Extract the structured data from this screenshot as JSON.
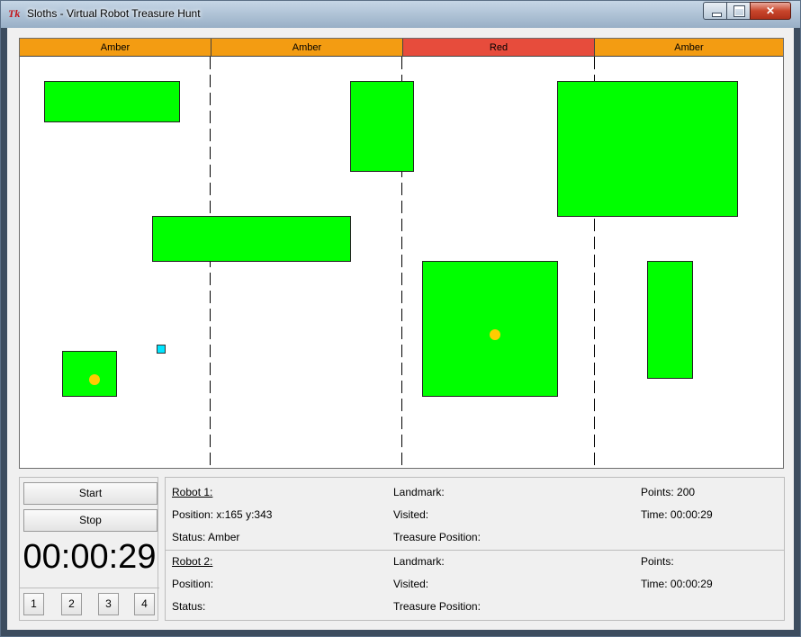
{
  "window": {
    "title": "Sloths - Virtual Robot Treasure Hunt",
    "icon": "tk-feather-icon"
  },
  "arena": {
    "zones": [
      {
        "label": "Amber",
        "color": "#f39c12"
      },
      {
        "label": "Amber",
        "color": "#f39c12"
      },
      {
        "label": "Red",
        "color": "#e74c3c"
      },
      {
        "label": "Amber",
        "color": "#f39c12"
      }
    ],
    "landmark_color": "#00ff00",
    "treasure_color": "#ffcc00",
    "robot_color": "#00e5ff"
  },
  "controls": {
    "start_label": "Start",
    "stop_label": "Stop",
    "timer": "00:00:29",
    "number_buttons": [
      "1",
      "2",
      "3",
      "4"
    ]
  },
  "robots": [
    {
      "heading": "Robot 1:",
      "position_label": "Position:",
      "position_value": "x:165 y:343",
      "status_label": "Status:",
      "status_value": "Amber",
      "landmark_label": "Landmark:",
      "visited_label": "Visited:",
      "treasure_label": "Treasure Position:",
      "points_label": "Points:",
      "points_value": "200",
      "time_label": "Time:",
      "time_value": "00:00:29"
    },
    {
      "heading": "Robot 2:",
      "position_label": "Position:",
      "position_value": "",
      "status_label": "Status:",
      "status_value": "",
      "landmark_label": "Landmark:",
      "visited_label": "Visited:",
      "treasure_label": "Treasure Position:",
      "points_label": "Points:",
      "points_value": "",
      "time_label": "Time:",
      "time_value": "00:00:29"
    }
  ]
}
